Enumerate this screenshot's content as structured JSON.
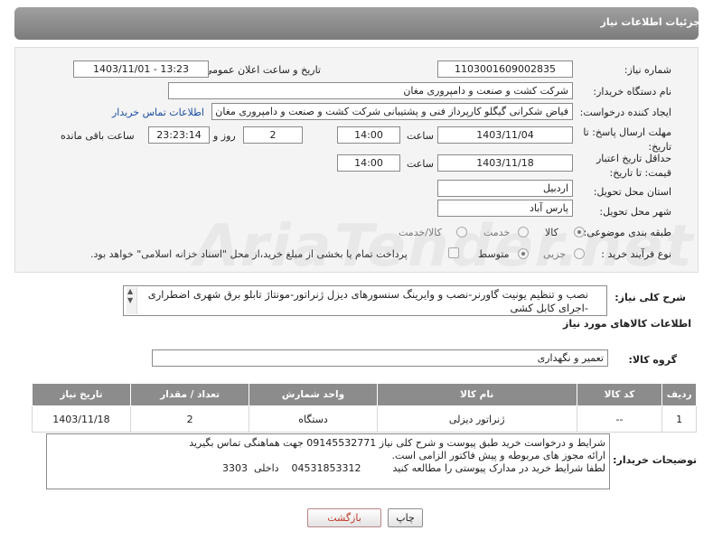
{
  "header": {
    "title": "جزئیات اطلاعات نیاز"
  },
  "watermark": {
    "text": "AriaTender.net"
  },
  "form": {
    "need_number_label": "شماره نیاز:",
    "need_number": "1103001609002835",
    "announce_label": "تاریخ و ساعت اعلان عمومی:",
    "announce_value": "1403/11/01 - 13:23",
    "buyer_org_label": "نام دستگاه خریدار:",
    "buyer_org": "شرکت کشت و صنعت و دامپروری مغان",
    "creator_label": "ایجاد کننده درخواست:",
    "creator": "فیاض شکرانی گیگلو کارپرداز فنی و پشتیبانی شرکت کشت و صنعت و دامپروری مغان",
    "buyer_contact_link": "اطلاعات تماس خریدار",
    "deadline_label": "مهلت ارسال پاسخ: تا تاریخ:",
    "deadline_date": "1403/11/04",
    "time_label": "ساعت",
    "deadline_time": "14:00",
    "days_value": "2",
    "days_label": "روز و",
    "remaining_time": "23:23:14",
    "remaining_label": "ساعت باقی مانده",
    "price_validity_label": "حداقل تاریخ اعتبار قیمت: تا تاریخ:",
    "price_validity_date": "1403/11/18",
    "price_validity_time": "14:00",
    "province_label": "استان محل تحویل:",
    "province": "اردبیل",
    "city_label": "شهر محل تحویل:",
    "city": "پارس آباد",
    "category_label": "طبقه بندی موضوعی:",
    "category_options": [
      "کالا",
      "خدمت",
      "کالا/خدمت"
    ],
    "process_label": "نوع فرآیند خرید :",
    "process_options": [
      "جزیی",
      "متوسط"
    ],
    "payment_note": "پرداخت تمام یا بخشی از مبلغ خرید،از محل \"اسناد خزانه اسلامی\" خواهد بود.",
    "description_label": "شرح کلی نیاز:",
    "description": "نصب و تنظیم یونیت گاورنر-نصب و وایرینگ سنسورهای دیزل ژنراتور-مونتاژ تابلو برق شهری اضطراری -اجرای کابل کشی"
  },
  "goods": {
    "section_title": "اطلاعات کالاهای مورد نیاز",
    "group_label": "گروه کالا:",
    "group_value": "تعمیر و نگهداری",
    "columns": [
      "ردیف",
      "کد کالا",
      "نام کالا",
      "واحد شمارش",
      "تعداد / مقدار",
      "تاریخ نیاز"
    ],
    "rows": [
      {
        "row": "1",
        "code": "--",
        "name": "ژنراتور دیزلی",
        "unit": "دستگاه",
        "qty": "2",
        "date": "1403/11/18"
      }
    ]
  },
  "buyer_notes": {
    "label": "توضیحات خریدار:",
    "line1": "شرایط و درخواست خرید طبق پیوست و شرح کلی نیاز 09145532771 جهت هماهنگی تماس بگیرید",
    "line2": "ارائه مجوز های مربوطه و پیش فاکتور الزامی است.",
    "line3": "لطفا شرایط خرید در مدارک پیوستی را مطالعه کنید          04531853312    داخلی  3303"
  },
  "buttons": {
    "print": "چاپ",
    "back": "بازگشت"
  }
}
